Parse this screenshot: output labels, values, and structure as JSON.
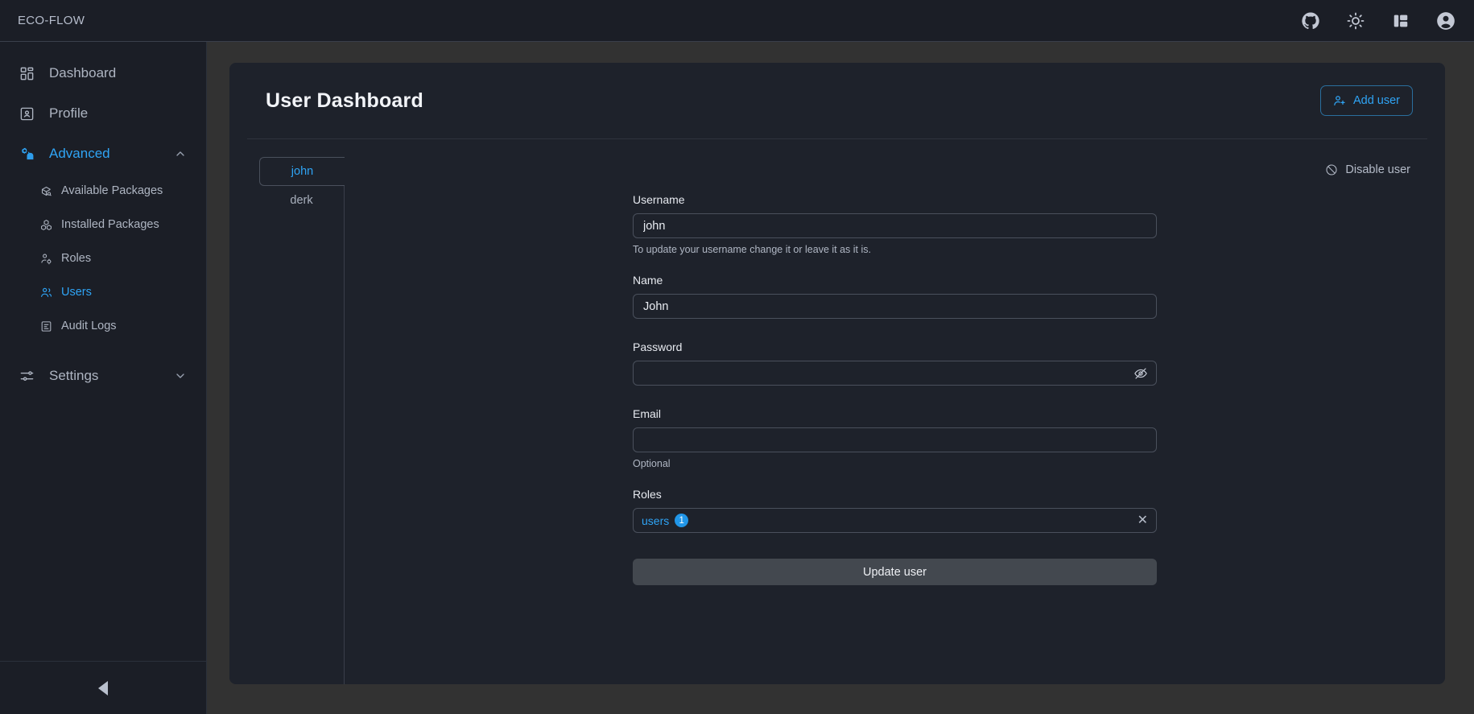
{
  "topbar": {
    "brand": "ECO-FLOW",
    "actions": [
      {
        "name": "github-icon",
        "label": "GitHub"
      },
      {
        "name": "sun-icon",
        "label": "Toggle theme"
      },
      {
        "name": "layout-panel-icon",
        "label": "Toggle layout"
      },
      {
        "name": "user-avatar-icon",
        "label": "Account"
      }
    ]
  },
  "sidebar": {
    "items": [
      {
        "label": "Dashboard",
        "icon": "dashboard-grid-icon"
      },
      {
        "label": "Profile",
        "icon": "profile-card-icon"
      },
      {
        "label": "Advanced",
        "icon": "advanced-cogs-icon",
        "chevron": "chevron-up-icon",
        "expanded": true,
        "active": true
      },
      {
        "label": "Settings",
        "icon": "sliders-icon",
        "chevron": "chevron-down-icon",
        "expanded": false
      }
    ],
    "advanced_children": [
      {
        "label": "Available Packages",
        "icon": "package-search-icon",
        "active": false
      },
      {
        "label": "Installed Packages",
        "icon": "packages-stack-icon",
        "active": false
      },
      {
        "label": "Roles",
        "icon": "user-cog-icon",
        "active": false
      },
      {
        "label": "Users",
        "icon": "users-icon",
        "active": true
      },
      {
        "label": "Audit Logs",
        "icon": "audit-log-icon",
        "active": false
      }
    ],
    "collapse_label": "Collapse sidebar"
  },
  "main": {
    "title": "User Dashboard",
    "add_user_label": "Add user",
    "disable_user_label": "Disable user",
    "user_tabs": [
      {
        "label": "john",
        "active": true
      },
      {
        "label": "derk",
        "active": false
      }
    ],
    "form": {
      "username": {
        "label": "Username",
        "value": "john",
        "placeholder": "",
        "help": "To update your username change it or leave it as it is."
      },
      "name": {
        "label": "Name",
        "value": "John",
        "placeholder": "",
        "help": ""
      },
      "password": {
        "label": "Password",
        "value": "",
        "placeholder": "",
        "help": "",
        "toggle_icon": "eye-off-icon"
      },
      "email": {
        "label": "Email",
        "value": "",
        "placeholder": "",
        "help": "Optional"
      },
      "roles": {
        "label": "Roles",
        "tag_label": "users",
        "tag_count": "1",
        "clear_label": "✕"
      },
      "submit_label": "Update user"
    }
  },
  "colors": {
    "accent": "#2fa4f5",
    "badge": "#2196e8",
    "sidebar_bg": "#1b1e26",
    "card_bg": "#1e222b",
    "page_bg": "#323232"
  }
}
